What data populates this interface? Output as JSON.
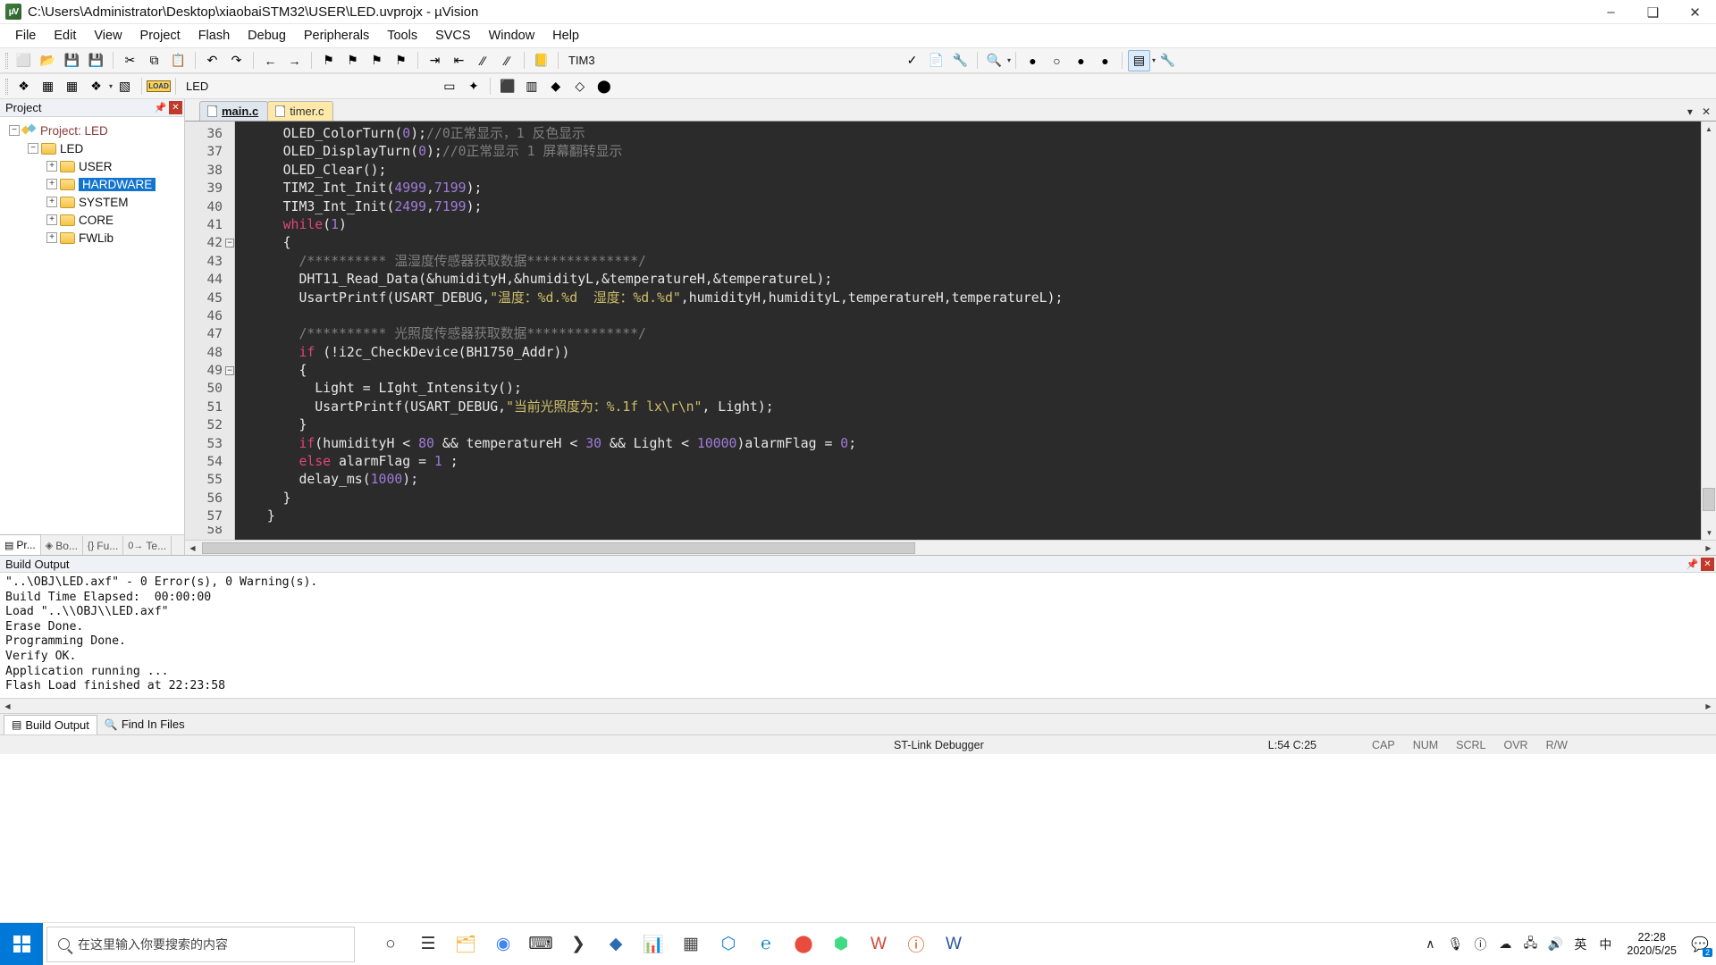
{
  "window": {
    "title": "C:\\Users\\Administrator\\Desktop\\xiaobaiSTM32\\USER\\LED.uvprojx - µVision",
    "logo_text": "µV",
    "minimize": "–",
    "maximize": "❑",
    "close": "✕"
  },
  "menubar": {
    "items": [
      {
        "label": "File"
      },
      {
        "label": "Edit"
      },
      {
        "label": "View"
      },
      {
        "label": "Project"
      },
      {
        "label": "Flash"
      },
      {
        "label": "Debug"
      },
      {
        "label": "Peripherals"
      },
      {
        "label": "Tools"
      },
      {
        "label": "SVCS"
      },
      {
        "label": "Window"
      },
      {
        "label": "Help"
      }
    ]
  },
  "toolbar1": {
    "target_label": "TIM3",
    "buttons": [
      {
        "name": "new-file-icon",
        "glyph": "⬜"
      },
      {
        "name": "open-file-icon",
        "glyph": "📂"
      },
      {
        "name": "save-icon",
        "glyph": "💾"
      },
      {
        "name": "save-all-icon",
        "glyph": "💾"
      },
      {
        "name": "cut-icon",
        "glyph": "✂"
      },
      {
        "name": "copy-icon",
        "glyph": "⧉"
      },
      {
        "name": "paste-icon",
        "glyph": "📋"
      },
      {
        "name": "undo-icon",
        "glyph": "↶"
      },
      {
        "name": "redo-icon",
        "glyph": "↷"
      },
      {
        "name": "navigate-back-icon",
        "glyph": "←"
      },
      {
        "name": "navigate-forward-icon",
        "glyph": "→"
      },
      {
        "name": "bookmark-toggle-icon",
        "glyph": "⚑"
      },
      {
        "name": "bookmark-prev-icon",
        "glyph": "⚑"
      },
      {
        "name": "bookmark-next-icon",
        "glyph": "⚑"
      },
      {
        "name": "bookmark-clear-icon",
        "glyph": "⚑"
      },
      {
        "name": "indent-icon",
        "glyph": "⇥"
      },
      {
        "name": "outdent-icon",
        "glyph": "⇤"
      },
      {
        "name": "comment-icon",
        "glyph": "∕∕"
      },
      {
        "name": "uncomment-icon",
        "glyph": "∕∕"
      },
      {
        "name": "target-options-icon",
        "glyph": "📒"
      }
    ],
    "right_buttons": [
      {
        "name": "checkbox-icon",
        "glyph": "✓"
      },
      {
        "name": "insert-file-icon",
        "glyph": "📄"
      },
      {
        "name": "configure-icon",
        "glyph": "🔧"
      },
      {
        "name": "find-icon",
        "glyph": "🔍"
      },
      {
        "name": "breakpoint-icon",
        "glyph": "●"
      },
      {
        "name": "breakpoint-disable-icon",
        "glyph": "○"
      },
      {
        "name": "breakpoint-clear-icon",
        "glyph": "●"
      },
      {
        "name": "breakpoint-kill-icon",
        "glyph": "●"
      },
      {
        "name": "window-layout-icon",
        "glyph": "▤"
      },
      {
        "name": "settings-wrench-icon",
        "glyph": "🔧"
      }
    ]
  },
  "toolbar2": {
    "project_label": "LED",
    "load_label": "LOAD",
    "buttons": [
      {
        "name": "translate-icon",
        "glyph": "❖"
      },
      {
        "name": "build-icon",
        "glyph": "▦"
      },
      {
        "name": "rebuild-icon",
        "glyph": "▦"
      },
      {
        "name": "batch-build-icon",
        "glyph": "❖"
      },
      {
        "name": "stop-build-icon",
        "glyph": "▧"
      },
      {
        "name": "download-icon",
        "glyph": "LOAD"
      }
    ],
    "right_buttons": [
      {
        "name": "target-select-icon",
        "glyph": "▭"
      },
      {
        "name": "magic-wand-icon",
        "glyph": "✦"
      },
      {
        "name": "manage-components-icon",
        "glyph": "⬛"
      },
      {
        "name": "pack-installer-icon",
        "glyph": "▥"
      },
      {
        "name": "books-icon",
        "glyph": "◆"
      },
      {
        "name": "gem-icon",
        "glyph": "◇"
      },
      {
        "name": "globe-icon",
        "glyph": "⬤"
      }
    ]
  },
  "project_panel": {
    "title": "Project",
    "pin_icon": "📌",
    "close_icon": "✕",
    "tree": [
      {
        "level": 0,
        "label": "Project: LED",
        "expander": "−",
        "icon": "project-icon",
        "selected": false
      },
      {
        "level": 1,
        "label": "LED",
        "expander": "−",
        "icon": "target-icon",
        "selected": false
      },
      {
        "level": 2,
        "label": "USER",
        "expander": "+",
        "icon": "folder-icon",
        "selected": false
      },
      {
        "level": 2,
        "label": "HARDWARE",
        "expander": "+",
        "icon": "folder-icon",
        "selected": true
      },
      {
        "level": 2,
        "label": "SYSTEM",
        "expander": "+",
        "icon": "folder-icon",
        "selected": false
      },
      {
        "level": 2,
        "label": "CORE",
        "expander": "+",
        "icon": "folder-icon",
        "selected": false
      },
      {
        "level": 2,
        "label": "FWLib",
        "expander": "+",
        "icon": "folder-icon",
        "selected": false
      }
    ],
    "tabs": [
      {
        "label": "Pr...",
        "glyph": "▤",
        "active": true
      },
      {
        "label": "Bo...",
        "glyph": "◈",
        "active": false
      },
      {
        "label": "Fu...",
        "glyph": "{}",
        "active": false
      },
      {
        "label": "Te...",
        "glyph": "0→",
        "active": false
      }
    ]
  },
  "editor": {
    "tabs": [
      {
        "label": "main.c",
        "active": true
      },
      {
        "label": "timer.c",
        "active": false
      }
    ],
    "minimize_icon": "▾",
    "close_icon": "✕",
    "first_line_number": 36,
    "lines": [
      {
        "n": 36,
        "fold": "",
        "tokens": [
          {
            "t": "pl",
            "v": "    OLED_ColorTurn("
          },
          {
            "t": "num",
            "v": "0"
          },
          {
            "t": "pl",
            "v": ");"
          },
          {
            "t": "cm",
            "v": "//0正常显示，1 反色显示"
          }
        ]
      },
      {
        "n": 37,
        "fold": "",
        "tokens": [
          {
            "t": "pl",
            "v": "    OLED_DisplayTurn("
          },
          {
            "t": "num",
            "v": "0"
          },
          {
            "t": "pl",
            "v": ");"
          },
          {
            "t": "cm",
            "v": "//0正常显示 1 屏幕翻转显示"
          }
        ]
      },
      {
        "n": 38,
        "fold": "",
        "tokens": [
          {
            "t": "pl",
            "v": "    OLED_Clear();"
          }
        ]
      },
      {
        "n": 39,
        "fold": "",
        "tokens": [
          {
            "t": "pl",
            "v": "    TIM2_Int_Init("
          },
          {
            "t": "num",
            "v": "4999"
          },
          {
            "t": "pl",
            "v": ","
          },
          {
            "t": "num",
            "v": "7199"
          },
          {
            "t": "pl",
            "v": ");"
          }
        ]
      },
      {
        "n": 40,
        "fold": "",
        "tokens": [
          {
            "t": "pl",
            "v": "    TIM3_Int_Init("
          },
          {
            "t": "num",
            "v": "2499"
          },
          {
            "t": "pl",
            "v": ","
          },
          {
            "t": "num",
            "v": "7199"
          },
          {
            "t": "pl",
            "v": ");"
          }
        ]
      },
      {
        "n": 41,
        "fold": "",
        "tokens": [
          {
            "t": "kw",
            "v": "    while"
          },
          {
            "t": "pl",
            "v": "("
          },
          {
            "t": "num",
            "v": "1"
          },
          {
            "t": "pl",
            "v": ")"
          }
        ]
      },
      {
        "n": 42,
        "fold": "−",
        "tokens": [
          {
            "t": "pl",
            "v": "    {"
          }
        ]
      },
      {
        "n": 43,
        "fold": "",
        "tokens": [
          {
            "t": "cm",
            "v": "      /********** 温湿度传感器获取数据**************/"
          }
        ]
      },
      {
        "n": 44,
        "fold": "",
        "tokens": [
          {
            "t": "pl",
            "v": "      DHT11_Read_Data(&humidityH,&humidityL,&temperatureH,&temperatureL);"
          }
        ]
      },
      {
        "n": 45,
        "fold": "",
        "tokens": [
          {
            "t": "pl",
            "v": "      UsartPrintf(USART_DEBUG,"
          },
          {
            "t": "str",
            "v": "\"温度：%d.%d  湿度：%d.%d\""
          },
          {
            "t": "pl",
            "v": ",humidityH,humidityL,temperatureH,temperatureL);"
          }
        ]
      },
      {
        "n": 46,
        "fold": "",
        "tokens": [
          {
            "t": "pl",
            "v": ""
          }
        ]
      },
      {
        "n": 47,
        "fold": "",
        "tokens": [
          {
            "t": "cm",
            "v": "      /********** 光照度传感器获取数据**************/"
          }
        ]
      },
      {
        "n": 48,
        "fold": "",
        "tokens": [
          {
            "t": "kw",
            "v": "      if"
          },
          {
            "t": "pl",
            "v": " (!i2c_CheckDevice(BH1750_Addr))"
          }
        ]
      },
      {
        "n": 49,
        "fold": "−",
        "tokens": [
          {
            "t": "pl",
            "v": "      {"
          }
        ]
      },
      {
        "n": 50,
        "fold": "",
        "tokens": [
          {
            "t": "pl",
            "v": "        Light = LIght_Intensity();"
          }
        ]
      },
      {
        "n": 51,
        "fold": "",
        "tokens": [
          {
            "t": "pl",
            "v": "        UsartPrintf(USART_DEBUG,"
          },
          {
            "t": "str",
            "v": "\"当前光照度为：%.1f lx\\r\\n\""
          },
          {
            "t": "pl",
            "v": ", Light);"
          }
        ]
      },
      {
        "n": 52,
        "fold": "",
        "tokens": [
          {
            "t": "pl",
            "v": "      }"
          }
        ]
      },
      {
        "n": 53,
        "fold": "",
        "tokens": [
          {
            "t": "kw",
            "v": "      if"
          },
          {
            "t": "pl",
            "v": "(humidityH < "
          },
          {
            "t": "num",
            "v": "80"
          },
          {
            "t": "pl",
            "v": " && temperatureH < "
          },
          {
            "t": "num",
            "v": "30"
          },
          {
            "t": "pl",
            "v": " && Light < "
          },
          {
            "t": "num",
            "v": "10000"
          },
          {
            "t": "pl",
            "v": ")alarmFlag = "
          },
          {
            "t": "num",
            "v": "0"
          },
          {
            "t": "pl",
            "v": ";"
          }
        ]
      },
      {
        "n": 54,
        "fold": "",
        "tokens": [
          {
            "t": "kw",
            "v": "      else"
          },
          {
            "t": "pl",
            "v": " alarmFlag = "
          },
          {
            "t": "num",
            "v": "1"
          },
          {
            "t": "pl",
            "v": " ;"
          }
        ]
      },
      {
        "n": 55,
        "fold": "",
        "tokens": [
          {
            "t": "pl",
            "v": "      delay_ms("
          },
          {
            "t": "num",
            "v": "1000"
          },
          {
            "t": "pl",
            "v": ");"
          }
        ]
      },
      {
        "n": 56,
        "fold": "",
        "tokens": [
          {
            "t": "pl",
            "v": "    }"
          }
        ]
      },
      {
        "n": 57,
        "fold": "",
        "tokens": [
          {
            "t": "pl",
            "v": "  }"
          }
        ]
      }
    ]
  },
  "build_output": {
    "title": "Build Output",
    "pin_icon": "📌",
    "close_icon": "✕",
    "lines": [
      "\"..\\OBJ\\LED.axf\" - 0 Error(s), 0 Warning(s).",
      "Build Time Elapsed:  00:00:00",
      "Load \"..\\\\OBJ\\\\LED.axf\"",
      "Erase Done.",
      "Programming Done.",
      "Verify OK.",
      "Application running ...",
      "Flash Load finished at 22:23:58"
    ],
    "tabs": [
      {
        "label": "Build Output",
        "glyph": "▤",
        "active": true
      },
      {
        "label": "Find In Files",
        "glyph": "🔍",
        "active": false
      }
    ]
  },
  "statusbar": {
    "debugger": "ST-Link Debugger",
    "position": "L:54 C:25",
    "flags": [
      "CAP",
      "NUM",
      "SCRL",
      "OVR",
      "R/W"
    ]
  },
  "taskbar": {
    "search_placeholder": "在这里输入你要搜索的内容",
    "start_icon": "windows-logo-icon",
    "icons": [
      {
        "name": "cortana-icon",
        "glyph": "○",
        "color": "#333"
      },
      {
        "name": "task-view-icon",
        "glyph": "☰",
        "color": "#333"
      },
      {
        "name": "file-explorer-icon",
        "glyph": "🗂",
        "color": "#f2b134"
      },
      {
        "name": "chrome-icon",
        "glyph": "◉",
        "color": "#4285f4"
      },
      {
        "name": "terminal-icon",
        "glyph": "⌨",
        "color": "#2b2b2b"
      },
      {
        "name": "xshell-icon",
        "glyph": "❯",
        "color": "#333"
      },
      {
        "name": "app-blue-icon",
        "glyph": "◆",
        "color": "#2b6cb0"
      },
      {
        "name": "charts-icon",
        "glyph": "📊",
        "color": "#c0392b"
      },
      {
        "name": "calculator-icon",
        "glyph": "▦",
        "color": "#444"
      },
      {
        "name": "vscode-icon",
        "glyph": "⬡",
        "color": "#1c7fd6"
      },
      {
        "name": "edge-icon",
        "glyph": "℮",
        "color": "#0b7ec4"
      },
      {
        "name": "record-icon",
        "glyph": "⬤",
        "color": "#e74c3c"
      },
      {
        "name": "android-studio-icon",
        "glyph": "⬢",
        "color": "#3ddc84"
      },
      {
        "name": "wps-icon",
        "glyph": "W",
        "color": "#d14836"
      },
      {
        "name": "keil-icon",
        "glyph": "ⓘ",
        "color": "#d35400"
      },
      {
        "name": "word-icon",
        "glyph": "W",
        "color": "#2b579a"
      }
    ],
    "tray": [
      {
        "name": "show-hidden-icons",
        "glyph": "∧"
      },
      {
        "name": "microphone-icon",
        "glyph": "🎙"
      },
      {
        "name": "keil-tray-icon",
        "glyph": "ⓘ"
      },
      {
        "name": "onedrive-icon",
        "glyph": "☁"
      },
      {
        "name": "network-icon",
        "glyph": "🖧"
      },
      {
        "name": "volume-icon",
        "glyph": "🔊"
      },
      {
        "name": "ime-icon",
        "glyph": "英"
      },
      {
        "name": "ime-extra-icon",
        "glyph": "中"
      }
    ],
    "clock_time": "22:28",
    "clock_date": "2020/5/25",
    "notification_count": "2"
  }
}
